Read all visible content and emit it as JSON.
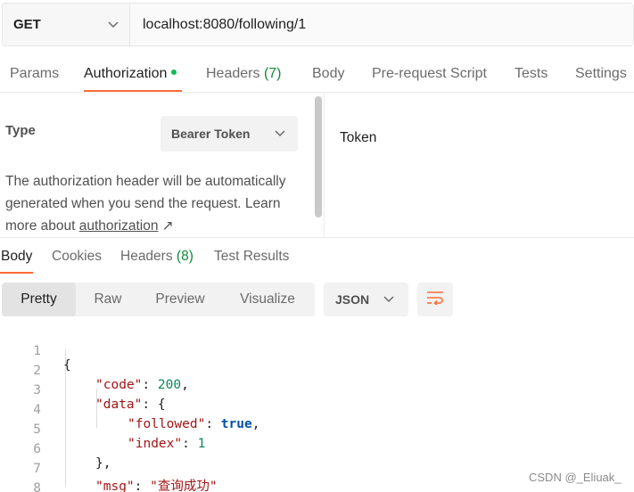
{
  "request": {
    "method": "GET",
    "url": "localhost:8080/following/1"
  },
  "request_tabs": [
    {
      "label": "Params",
      "count": ""
    },
    {
      "label": "Authorization",
      "count": ""
    },
    {
      "label": "Headers",
      "count": "(7)"
    },
    {
      "label": "Body",
      "count": ""
    },
    {
      "label": "Pre-request Script",
      "count": ""
    },
    {
      "label": "Tests",
      "count": ""
    },
    {
      "label": "Settings",
      "count": ""
    }
  ],
  "auth": {
    "type_label": "Type",
    "type_value": "Bearer Token",
    "description": "The authorization header will be automatically generated when you send the request. Learn more about ",
    "link": "authorization",
    "link_arrow": "↗",
    "token_label": "Token"
  },
  "response_tabs": [
    {
      "label": "Body",
      "count": ""
    },
    {
      "label": "Cookies",
      "count": ""
    },
    {
      "label": "Headers",
      "count": "(8)"
    },
    {
      "label": "Test Results",
      "count": ""
    }
  ],
  "view_modes": [
    "Pretty",
    "Raw",
    "Preview",
    "Visualize"
  ],
  "format": "JSON",
  "code_lines": [
    "1",
    "2",
    "3",
    "4",
    "5",
    "6",
    "7",
    "8"
  ],
  "json": {
    "code_key": "\"code\"",
    "code_val": "200",
    "data_key": "\"data\"",
    "followed_key": "\"followed\"",
    "followed_val": "true",
    "index_key": "\"index\"",
    "index_val": "1",
    "msg_key": "\"msg\"",
    "msg_val": "\"查询成功\""
  },
  "watermark": "CSDN @_Eliuak_",
  "colors": {
    "accent": "#ff6c37",
    "status_dot": "#0cbb52",
    "count": "#0f8a3c"
  }
}
